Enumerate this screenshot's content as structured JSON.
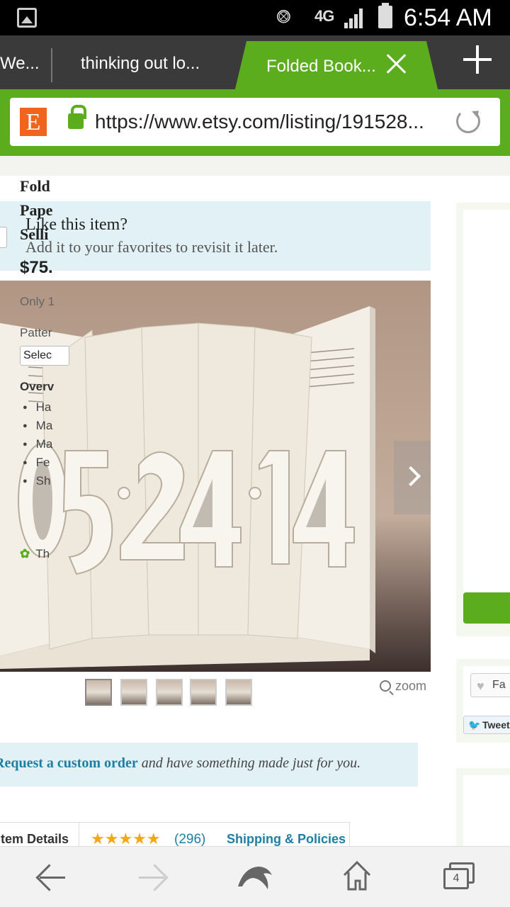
{
  "status_bar": {
    "network": "4G",
    "time": "6:54 AM",
    "icons": [
      "gallery-icon",
      "mute-icon",
      "signal-icon",
      "battery-icon"
    ]
  },
  "tabs": [
    {
      "label": "We...",
      "active": false
    },
    {
      "label": "thinking out lo...",
      "active": false
    },
    {
      "label": "Folded Book...",
      "active": true
    }
  ],
  "url_bar": {
    "site_icon": "E",
    "url": "https://www.etsy.com/listing/191528..."
  },
  "favorite_prompt": {
    "heading": "Like this item?",
    "subtext": "Add it to your favorites to revisit it later."
  },
  "photo": {
    "description_digits": "05·24·14"
  },
  "gallery": {
    "thumbnail_count": 5,
    "selected_index": 0,
    "zoom_label": "zoom"
  },
  "custom_order": {
    "link": "Request a custom order",
    "text": " and have something made just for you."
  },
  "detail_tabs": {
    "item_details": "Item Details",
    "stars": "★★★★★",
    "review_count": "(296)",
    "shipping": "Shipping & Policies"
  },
  "listing": {
    "title": "Fold\nPape\nSelli",
    "price": "$75.",
    "availability": "Only 1",
    "pattern_label": "Patter",
    "select_placeholder": "Selec",
    "overview_label": "Overv",
    "overview_items": [
      "Ha",
      "Ma",
      "Ma",
      "Fe",
      "Sh"
    ],
    "leaf_text": "Th"
  },
  "social": {
    "favorite_label": "Fa",
    "tweet_label": "Tweet"
  },
  "bottom_nav": {
    "tab_count": "4"
  },
  "colors": {
    "accent_green": "#5cad1e",
    "etsy_orange": "#f1641e",
    "link_blue": "#1e7fa3",
    "info_box": "#e2f1f5"
  }
}
